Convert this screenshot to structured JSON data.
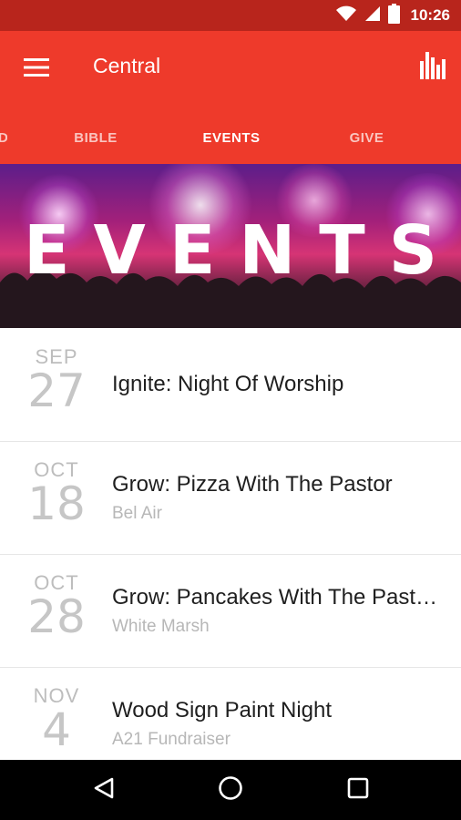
{
  "status_bar": {
    "time": "10:26",
    "icons": [
      "wifi-icon",
      "signal-icon",
      "battery-icon"
    ]
  },
  "app_bar": {
    "title": "Central",
    "menu_icon": "hamburger-menu-icon",
    "action_icon": "bar-chart-icon"
  },
  "tabs": [
    {
      "label": "D",
      "active": false
    },
    {
      "label": "BIBLE",
      "active": false
    },
    {
      "label": "EVENTS",
      "active": true
    },
    {
      "label": "GIVE",
      "active": false
    }
  ],
  "hero": {
    "title": "EVENTS"
  },
  "events": [
    {
      "month": "SEP",
      "day": "27",
      "title": "Ignite: Night Of Worship",
      "subtitle": ""
    },
    {
      "month": "OCT",
      "day": "18",
      "title": "Grow: Pizza With The Pastor",
      "subtitle": "Bel Air"
    },
    {
      "month": "OCT",
      "day": "28",
      "title": "Grow: Pancakes With The Past…",
      "subtitle": "White Marsh"
    },
    {
      "month": "NOV",
      "day": "4",
      "title": "Wood Sign Paint Night",
      "subtitle": "A21 Fundraiser"
    }
  ],
  "nav_bar": {
    "icons": [
      "back-icon",
      "home-icon",
      "recents-icon"
    ]
  },
  "colors": {
    "status_bar": "#b8251c",
    "app_bar": "#ee3a2b",
    "nav_bar": "#000000"
  }
}
